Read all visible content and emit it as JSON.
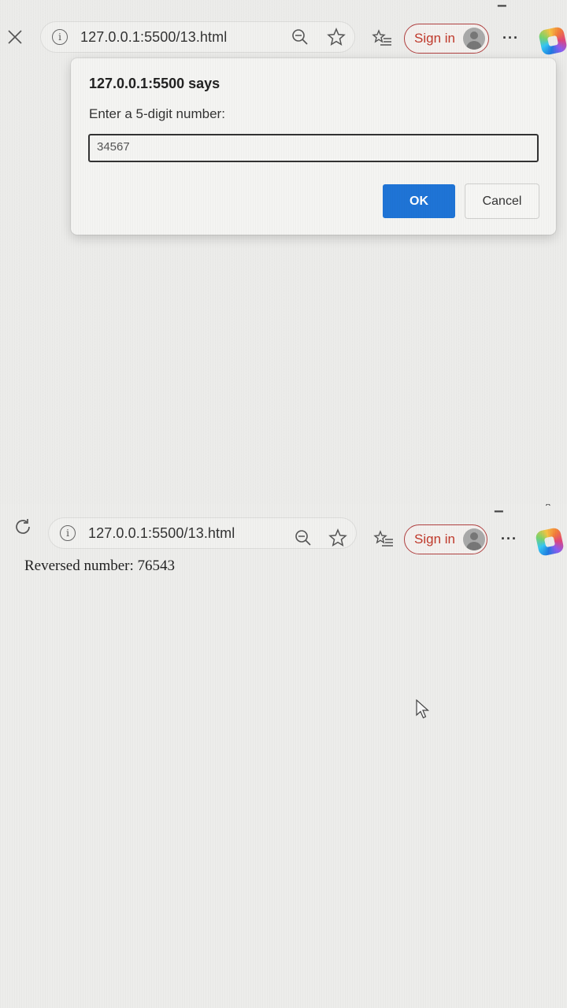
{
  "top": {
    "browser": {
      "url": "127.0.0.1:5500/13.html",
      "signin_label": "Sign in",
      "more_label": "···"
    },
    "dialog": {
      "title": "127.0.0.1:5500 says",
      "message": "Enter a 5-digit number:",
      "input_value": "34567",
      "ok_label": "OK",
      "cancel_label": "Cancel"
    }
  },
  "bottom": {
    "browser": {
      "url": "127.0.0.1:5500/13.html",
      "signin_label": "Sign in",
      "more_label": "···"
    },
    "output_text": "Reversed number: 76543"
  },
  "icons": [
    "close-icon",
    "reload-icon",
    "site-info-icon",
    "zoom-icon",
    "favorite-star-icon",
    "favorites-list-icon",
    "profile-avatar-icon",
    "more-options-icon",
    "copilot-icon",
    "mouse-cursor-icon"
  ],
  "colors": {
    "primary_button": "#1f74d6",
    "signin_border": "#b04040",
    "signin_text": "#c0392b"
  }
}
